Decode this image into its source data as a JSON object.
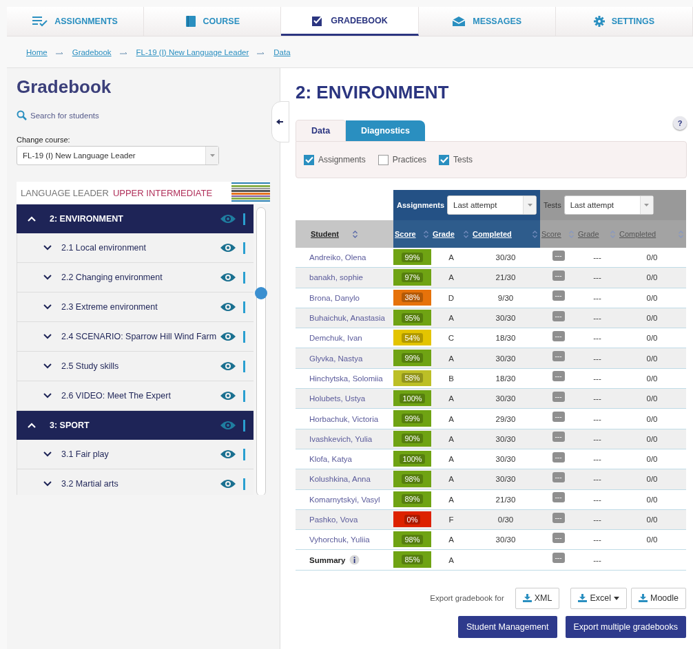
{
  "nav_tabs": [
    {
      "label": "ASSIGNMENTS",
      "selected": false
    },
    {
      "label": "COURSE",
      "selected": false
    },
    {
      "label": "GRADEBOOK",
      "selected": true
    },
    {
      "label": "MESSAGES",
      "selected": false
    },
    {
      "label": "SETTINGS",
      "selected": false
    }
  ],
  "breadcrumb": [
    "Home",
    "Gradebook",
    "FL-19 (I) New Language Leader",
    "Data"
  ],
  "sidebar": {
    "title": "Gradebook",
    "search_link": "Search for students",
    "course_label": "Change course:",
    "course_value": "FL-19 (I) New Language Leader",
    "banner": {
      "brand": "LANGUAGE LEADER",
      "level": "UPPER INTERMEDIATE"
    },
    "units": [
      {
        "label": "2: ENVIRONMENT",
        "expanded": true,
        "children": [
          {
            "label": "2.1 Local environment",
            "expanded": false
          },
          {
            "label": "2.2 Changing environment",
            "expanded": false
          },
          {
            "label": "2.3 Extreme environment",
            "expanded": false
          },
          {
            "label": "2.4 SCENARIO: Sparrow Hill Wind Farm",
            "expanded": false
          },
          {
            "label": "2.5 Study skills",
            "expanded": false
          },
          {
            "label": "2.6 VIDEO: Meet The Expert",
            "expanded": false
          }
        ]
      },
      {
        "label": "3: SPORT",
        "expanded": true,
        "children": [
          {
            "label": "3.1 Fair play",
            "expanded": false
          },
          {
            "label": "3.2 Martial arts",
            "expanded": false
          }
        ]
      }
    ]
  },
  "content": {
    "title": "2: ENVIRONMENT",
    "help": "?",
    "tabs": [
      {
        "label": "Data",
        "selected": true
      },
      {
        "label": "Diagnostics",
        "selected": false
      }
    ],
    "filters": [
      {
        "label": "Assignments",
        "checked": true
      },
      {
        "label": "Practices",
        "checked": false
      },
      {
        "label": "Tests",
        "checked": true
      }
    ],
    "groups": [
      {
        "label": "Assignments",
        "kind": "primary",
        "attempt": "Last attempt"
      },
      {
        "label": "Tests",
        "kind": "muted",
        "attempt": "Last attempt"
      }
    ],
    "columns": [
      "Student",
      "Score",
      "Grade",
      "Completed",
      "Score",
      "Grade",
      "Completed"
    ],
    "rows": [
      {
        "student": "Andreiko, Olena",
        "score": "99%",
        "color": "#6fa313",
        "grade": "A",
        "completed": "30/30",
        "test_score": "---",
        "test_grade": "---",
        "test_completed": "0/0"
      },
      {
        "student": "banakh, sophie",
        "score": "97%",
        "color": "#6fa313",
        "grade": "A",
        "completed": "21/30",
        "test_score": "---",
        "test_grade": "---",
        "test_completed": "0/0"
      },
      {
        "student": "Brona, Danylo",
        "score": "38%",
        "color": "#e6720a",
        "grade": "D",
        "completed": "9/30",
        "test_score": "---",
        "test_grade": "---",
        "test_completed": "0/0"
      },
      {
        "student": "Buhaichuk, Anastasia",
        "score": "95%",
        "color": "#6fa313",
        "grade": "A",
        "completed": "30/30",
        "test_score": "---",
        "test_grade": "---",
        "test_completed": "0/0"
      },
      {
        "student": "Demchuk, Ivan",
        "score": "54%",
        "color": "#e3c400",
        "grade": "C",
        "completed": "18/30",
        "test_score": "---",
        "test_grade": "---",
        "test_completed": "0/0"
      },
      {
        "student": "Glyvka, Nastya",
        "score": "99%",
        "color": "#6fa313",
        "grade": "A",
        "completed": "30/30",
        "test_score": "---",
        "test_grade": "---",
        "test_completed": "0/0"
      },
      {
        "student": "Hinchytska, Solomiia",
        "score": "58%",
        "color": "#bcbf26",
        "grade": "B",
        "completed": "18/30",
        "test_score": "---",
        "test_grade": "---",
        "test_completed": "0/0"
      },
      {
        "student": "Holubets, Ustya",
        "score": "100%",
        "color": "#6fa313",
        "grade": "A",
        "completed": "30/30",
        "test_score": "---",
        "test_grade": "---",
        "test_completed": "0/0"
      },
      {
        "student": "Horbachuk, Victoria",
        "score": "99%",
        "color": "#6fa313",
        "grade": "A",
        "completed": "29/30",
        "test_score": "---",
        "test_grade": "---",
        "test_completed": "0/0"
      },
      {
        "student": "Ivashkevich, Yulia",
        "score": "90%",
        "color": "#6fa313",
        "grade": "A",
        "completed": "30/30",
        "test_score": "---",
        "test_grade": "---",
        "test_completed": "0/0"
      },
      {
        "student": "Klofa, Katya",
        "score": "100%",
        "color": "#6fa313",
        "grade": "A",
        "completed": "30/30",
        "test_score": "---",
        "test_grade": "---",
        "test_completed": "0/0"
      },
      {
        "student": "Kolushkina, Anna",
        "score": "98%",
        "color": "#6fa313",
        "grade": "A",
        "completed": "30/30",
        "test_score": "---",
        "test_grade": "---",
        "test_completed": "0/0"
      },
      {
        "student": "Komarnytskyi, Vasyl",
        "score": "89%",
        "color": "#6fa313",
        "grade": "A",
        "completed": "21/30",
        "test_score": "---",
        "test_grade": "---",
        "test_completed": "0/0"
      },
      {
        "student": "Pashko, Vova",
        "score": "0%",
        "color": "#dd2200",
        "grade": "F",
        "completed": "0/30",
        "test_score": "---",
        "test_grade": "---",
        "test_completed": "0/0"
      },
      {
        "student": "Vyhorchuk, Yuliia",
        "score": "98%",
        "color": "#6fa313",
        "grade": "A",
        "completed": "30/30",
        "test_score": "---",
        "test_grade": "---",
        "test_completed": "0/0"
      }
    ],
    "summary": {
      "label": "Summary",
      "score": "85%",
      "color": "#6fa313",
      "grade": "A",
      "test_score": "---",
      "test_grade": "---"
    },
    "export_label": "Export gradebook for",
    "export_buttons": [
      {
        "label": "XML",
        "dropdown": false
      },
      {
        "label": "Excel",
        "dropdown": true
      },
      {
        "label": "Moodle",
        "dropdown": false
      }
    ],
    "actions": [
      "Student Management",
      "Export multiple gradebooks"
    ]
  }
}
